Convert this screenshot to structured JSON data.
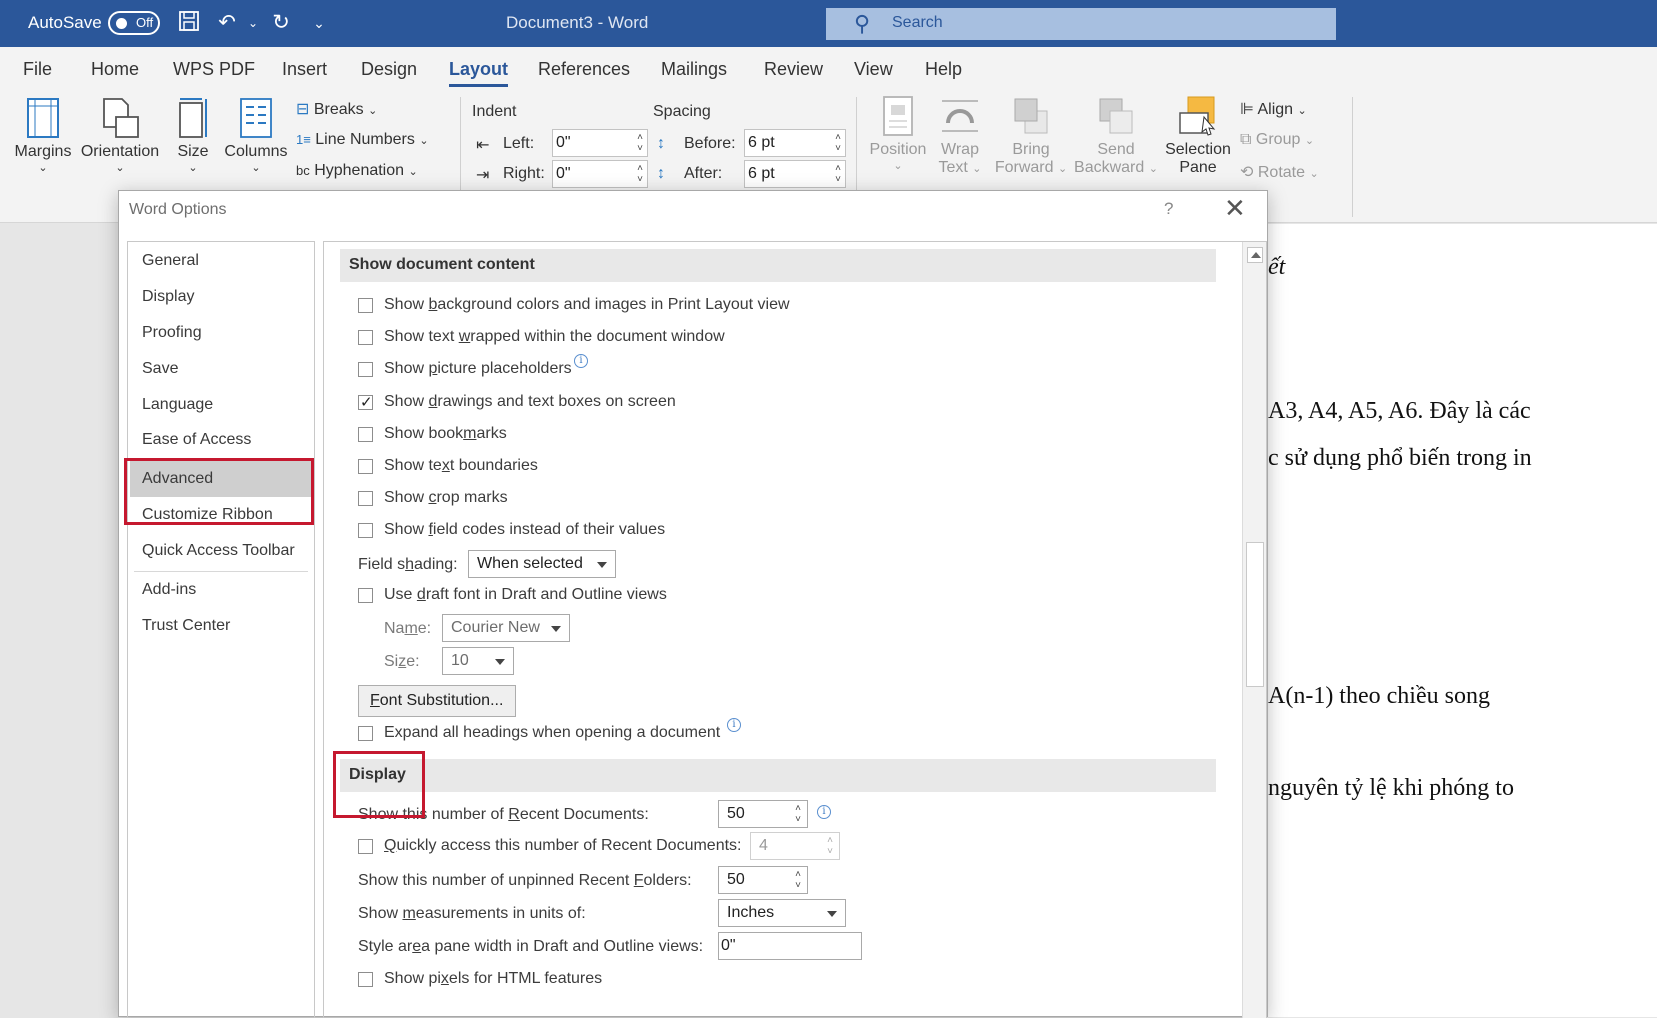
{
  "titlebar": {
    "autosave_label": "AutoSave",
    "autosave_state": "Off",
    "document_name": "Document3  -  Word",
    "search_placeholder": "Search"
  },
  "menu": [
    "File",
    "Home",
    "WPS PDF",
    "Insert",
    "Design",
    "Layout",
    "References",
    "Mailings",
    "Review",
    "View",
    "Help"
  ],
  "menu_active": "Layout",
  "ribbon": {
    "margins": "Margins",
    "orientation": "Orientation",
    "size": "Size",
    "columns": "Columns",
    "breaks": "Breaks",
    "line_numbers": "Line Numbers",
    "hyphenation": "Hyphenation",
    "indent_title": "Indent",
    "indent_left_label": "Left:",
    "indent_left_value": "0\"",
    "indent_right_label": "Right:",
    "indent_right_value": "0\"",
    "spacing_title": "Spacing",
    "before_label": "Before:",
    "before_value": "6 pt",
    "after_label": "After:",
    "after_value": "6 pt",
    "position": "Position",
    "wrap_text_1": "Wrap",
    "wrap_text_2": "Text",
    "bring_forward_1": "Bring",
    "bring_forward_2": "Forward",
    "send_backward_1": "Send",
    "send_backward_2": "Backward",
    "selection_pane_1": "Selection",
    "selection_pane_2": "Pane",
    "align": "Align",
    "group": "Group",
    "rotate": "Rotate"
  },
  "document_lines": [
    "ết",
    "A3, A4, A5, A6. Đây là các",
    "c sử dụng phổ biến trong in",
    "A(n-1) theo chiều song",
    "nguyên tỷ lệ khi phóng to"
  ],
  "dialog": {
    "title": "Word Options",
    "help": "?",
    "close": "✕",
    "nav": [
      "General",
      "Display",
      "Proofing",
      "Save",
      "Language",
      "Ease of Access",
      "Advanced",
      "Customize Ribbon",
      "Quick Access Toolbar",
      "Add-ins",
      "Trust Center"
    ],
    "nav_active": "Advanced",
    "section_show_content": "Show document content",
    "opt_background": [
      "Show ",
      "b",
      "ackground colors and images in Print Layout view"
    ],
    "opt_text_wrapped": [
      "Show text ",
      "w",
      "rapped within the document window"
    ],
    "opt_picture": [
      "Show ",
      "p",
      "icture placeholders"
    ],
    "opt_drawings": [
      "Show ",
      "d",
      "rawings and text boxes on screen"
    ],
    "opt_bookmarks": [
      "Show book",
      "m",
      "arks"
    ],
    "opt_text_boundaries": [
      "Show te",
      "x",
      "t boundaries"
    ],
    "opt_crop": [
      "Show ",
      "c",
      "rop marks"
    ],
    "opt_field_codes": [
      "Show ",
      "f",
      "ield codes instead of their values"
    ],
    "field_shading_label": [
      "Field s",
      "h",
      "ading:"
    ],
    "field_shading_value": "When selected",
    "opt_draft_font": [
      "Use ",
      "d",
      "raft font in Draft and Outline views"
    ],
    "name_label": [
      "Na",
      "m",
      "e:"
    ],
    "name_value": "Courier New",
    "size_label": [
      "Si",
      "z",
      "e:"
    ],
    "size_value": "10",
    "font_sub_button": [
      "F",
      "ont Substitution..."
    ],
    "opt_expand_headings": "Expand all headings when opening a document",
    "section_display": "Display",
    "recent_docs_label": [
      "Show this number of ",
      "R",
      "ecent Documents:"
    ],
    "recent_docs_value": "50",
    "quick_access_label": [
      "Q",
      "uickly access this number of Recent Documents:"
    ],
    "quick_access_value": "4",
    "recent_folders_label": [
      "Show this number of unpinned Recent ",
      "F",
      "olders:"
    ],
    "recent_folders_value": "50",
    "measurements_label": [
      "Show ",
      "m",
      "easurements in units of:"
    ],
    "measurements_value": "Inches",
    "style_area_label": [
      "Style ar",
      "e",
      "a pane width in Draft and Outline views:"
    ],
    "style_area_value": "0\"",
    "opt_pixels": [
      "Show pi",
      "x",
      "els for HTML features"
    ]
  },
  "colors": {
    "titlebar": "#2b579a",
    "highlight_box": "#c5182f",
    "nav_selected": "#cfcfcf"
  },
  "icons": {
    "save": "floppy-disk-icon",
    "undo": "undo-icon",
    "redo": "redo-icon",
    "search": "magnifier-icon"
  }
}
